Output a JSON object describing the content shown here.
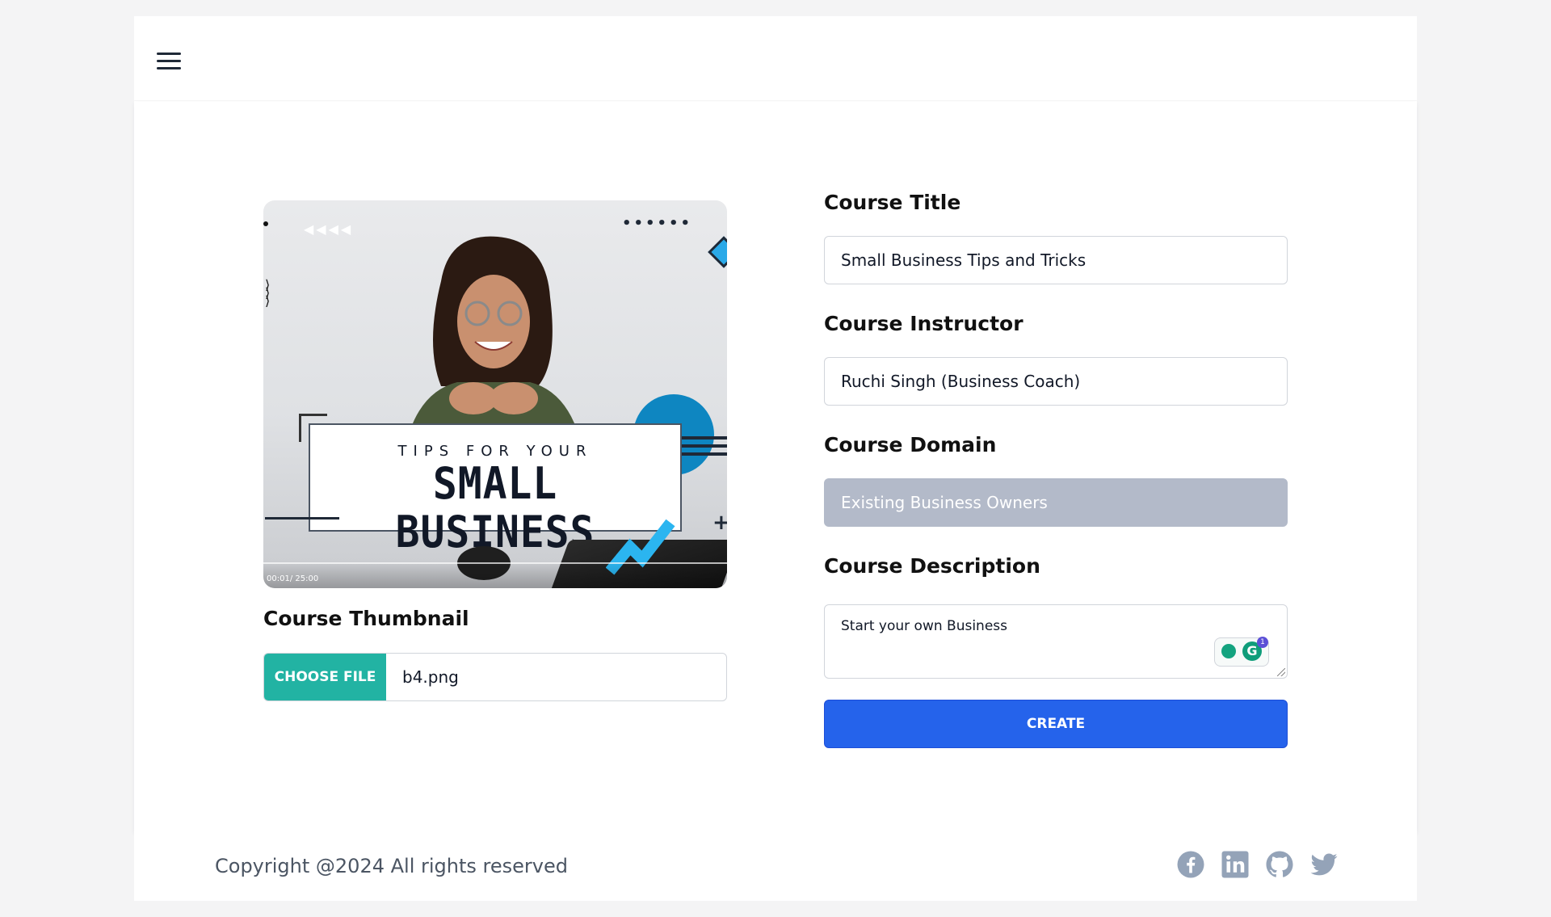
{
  "header": {
    "menu_icon": "hamburger-menu-icon"
  },
  "thumbnail": {
    "banner_small": "TIPS FOR YOUR",
    "banner_big": "SMALL BUSINESS",
    "time": "00:01/ 25:00",
    "label": "Course Thumbnail",
    "choose_file_label": "CHOOSE FILE",
    "file_name": "b4.png"
  },
  "form": {
    "title_label": "Course Title",
    "title_value": "Small Business Tips and Tricks",
    "instructor_label": "Course Instructor",
    "instructor_value": "Ruchi Singh (Business Coach)",
    "domain_label": "Course Domain",
    "domain_value": "Existing Business Owners",
    "description_label": "Course Description",
    "description_value": "Start your own Business",
    "grammarly_badge": "1",
    "grammarly_letter": "G",
    "create_label": "CREATE"
  },
  "footer": {
    "copyright": "Copyright @2024 All rights reserved",
    "social_icons": [
      "facebook-icon",
      "linkedin-icon",
      "github-icon",
      "twitter-icon"
    ]
  },
  "colors": {
    "choose_file_bg": "#22b3a3",
    "create_bg": "#2563eb",
    "disabled_field_bg": "#b3bac9",
    "social_icon": "#94a3b8"
  }
}
